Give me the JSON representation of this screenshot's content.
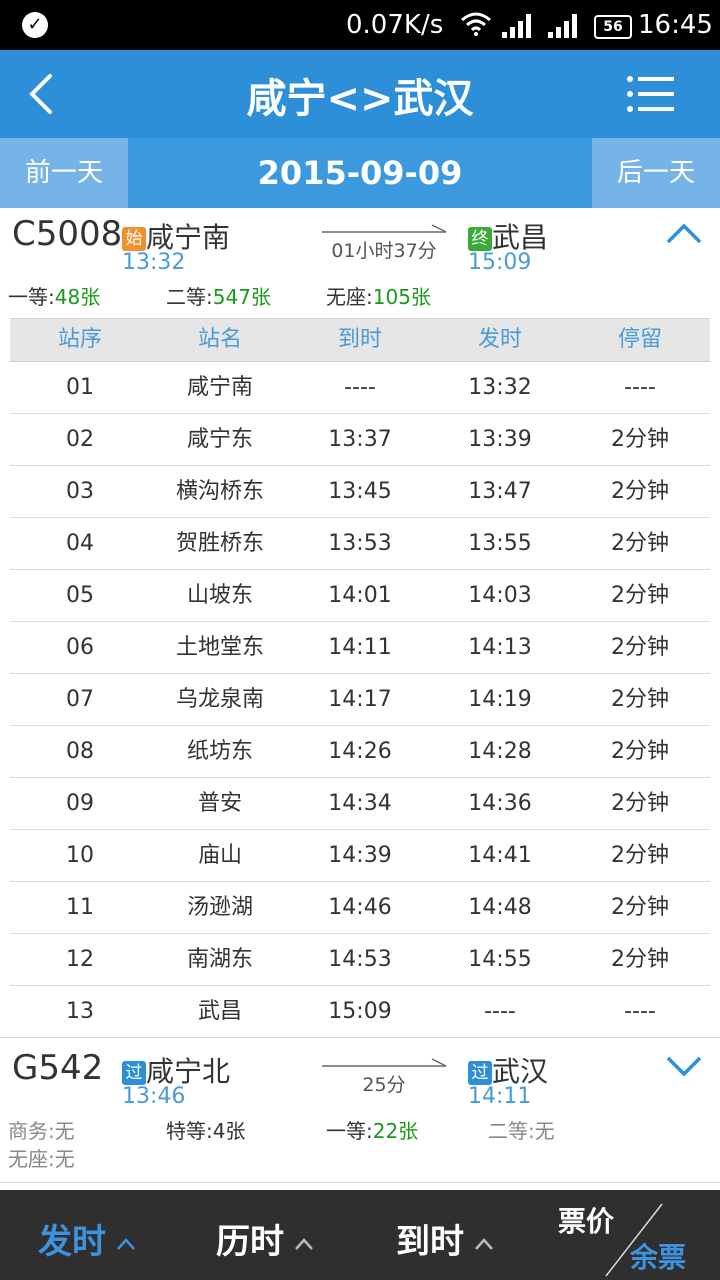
{
  "status": {
    "speed": "0.07K/s",
    "battery": "56",
    "time": "16:45"
  },
  "header": {
    "title": "咸宁<>武汉"
  },
  "datebar": {
    "prev": "前一天",
    "date": "2015-09-09",
    "next": "后一天"
  },
  "train1": {
    "code": "C5008",
    "from_badge": "始",
    "from": "咸宁南",
    "from_time": "13:32",
    "duration": "01小时37分",
    "to_badge": "终",
    "to": "武昌",
    "to_time": "15:09",
    "seats": [
      {
        "label": "一等:",
        "value": "48张"
      },
      {
        "label": "二等:",
        "value": "547张"
      },
      {
        "label": "无座:",
        "value": "105张"
      }
    ]
  },
  "stops_table": {
    "headers": [
      "站序",
      "站名",
      "到时",
      "发时",
      "停留"
    ],
    "rows": [
      [
        "01",
        "咸宁南",
        "----",
        "13:32",
        "----"
      ],
      [
        "02",
        "咸宁东",
        "13:37",
        "13:39",
        "2分钟"
      ],
      [
        "03",
        "横沟桥东",
        "13:45",
        "13:47",
        "2分钟"
      ],
      [
        "04",
        "贺胜桥东",
        "13:53",
        "13:55",
        "2分钟"
      ],
      [
        "05",
        "山坡东",
        "14:01",
        "14:03",
        "2分钟"
      ],
      [
        "06",
        "土地堂东",
        "14:11",
        "14:13",
        "2分钟"
      ],
      [
        "07",
        "乌龙泉南",
        "14:17",
        "14:19",
        "2分钟"
      ],
      [
        "08",
        "纸坊东",
        "14:26",
        "14:28",
        "2分钟"
      ],
      [
        "09",
        "普安",
        "14:34",
        "14:36",
        "2分钟"
      ],
      [
        "10",
        "庙山",
        "14:39",
        "14:41",
        "2分钟"
      ],
      [
        "11",
        "汤逊湖",
        "14:46",
        "14:48",
        "2分钟"
      ],
      [
        "12",
        "南湖东",
        "14:53",
        "14:55",
        "2分钟"
      ],
      [
        "13",
        "武昌",
        "15:09",
        "----",
        "----"
      ]
    ]
  },
  "train2": {
    "code": "G542",
    "from_badge": "过",
    "from": "咸宁北",
    "from_time": "13:46",
    "duration": "25分",
    "to_badge": "过",
    "to": "武汉",
    "to_time": "14:11",
    "seats": [
      {
        "label": "商务:",
        "value": "无"
      },
      {
        "label": "特等:",
        "value": "4张"
      },
      {
        "label": "一等:",
        "value": "22张"
      },
      {
        "label": "二等:",
        "value": "无"
      },
      {
        "label": "无座:",
        "value": "无"
      }
    ]
  },
  "bottom": {
    "depart": "发时",
    "duration": "历时",
    "arrive": "到时",
    "price": "票价",
    "remaining": "余票"
  },
  "colors": {
    "primary": "#2d8fd8",
    "start_badge": "#f0922b",
    "end_badge": "#3aaa3a",
    "pass_badge": "#2d8fd8",
    "seat_green": "#1a9a1a"
  }
}
